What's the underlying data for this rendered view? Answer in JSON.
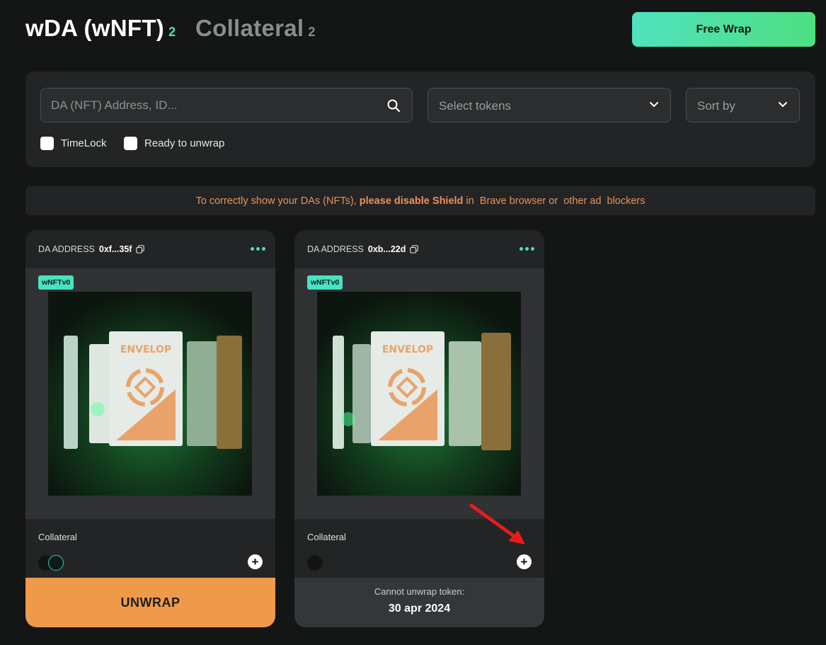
{
  "header": {
    "tab_wda": {
      "label": "wDA (wNFT)",
      "count": "2"
    },
    "tab_collateral": {
      "label": "Collateral",
      "count": "2"
    },
    "free_wrap_label": "Free Wrap"
  },
  "filters": {
    "search_placeholder": "DA (NFT) Address, ID...",
    "select_tokens_label": "Select tokens",
    "sort_by_label": "Sort by",
    "timelock_label": "TimeLock",
    "ready_label": "Ready to unwrap"
  },
  "notice": {
    "part1": "To correctly show your DAs (NFTs), ",
    "bold": "please disable Shield",
    "part2": " in  Brave browser or  other ad  blockers"
  },
  "cards": [
    {
      "address_label": "DA ADDRESS",
      "address_value": "0xf...35f",
      "badge": "wNFTv0",
      "art_text": "ENVELOP",
      "collateral_label": "Collateral",
      "action_label": "UNWRAP"
    },
    {
      "address_label": "DA ADDRESS",
      "address_value": "0xb...22d",
      "badge": "wNFTv0",
      "art_text": "ENVELOP",
      "collateral_label": "Collateral",
      "locked_label": "Cannot unwrap token:",
      "locked_date": "30 apr 2024"
    }
  ],
  "colors": {
    "accent": "#47e3b5",
    "unwrap": "#ef9a4a",
    "notice_text": "#e8935a",
    "annotation_arrow": "#e81c1c"
  }
}
